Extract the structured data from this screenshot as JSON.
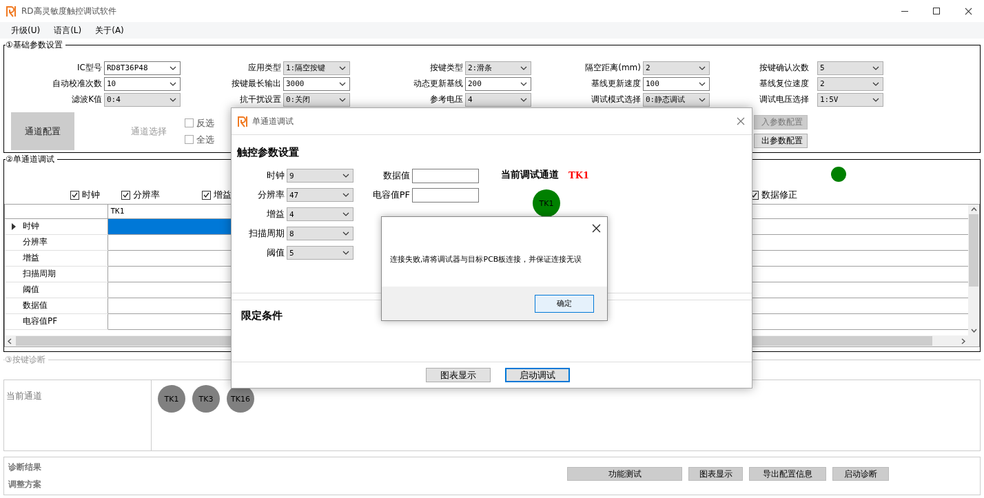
{
  "window": {
    "title": "RD高灵敏度触控调试软件"
  },
  "menu": [
    {
      "label": "升级(U)"
    },
    {
      "label": "语言(L)"
    },
    {
      "label": "关于(A)"
    }
  ],
  "basic": {
    "title": "①基础参数设置",
    "columns": [
      [
        {
          "label": "IC型号",
          "value": "RD8T36P48",
          "kind": "edit"
        },
        {
          "label": "自动校准次数",
          "value": "10",
          "kind": "edit"
        },
        {
          "label": "滤波K值",
          "value": "0:4",
          "kind": "list"
        }
      ],
      [
        {
          "label": "应用类型",
          "value": "1:隔空按键",
          "kind": "list"
        },
        {
          "label": "按键最长输出",
          "value": "3000",
          "kind": "edit"
        },
        {
          "label": "抗干扰设置",
          "value": "0:关闭",
          "kind": "list"
        }
      ],
      [
        {
          "label": "按键类型",
          "value": "2:滑条",
          "kind": "list"
        },
        {
          "label": "动态更新基线",
          "value": "200",
          "kind": "edit"
        },
        {
          "label": "参考电压",
          "value": "4",
          "kind": "list"
        }
      ],
      [
        {
          "label": "隔空距离(mm)",
          "value": "2",
          "kind": "list"
        },
        {
          "label": "基线更新速度",
          "value": "100",
          "kind": "edit"
        },
        {
          "label": "调试模式选择",
          "value": "0:静态调试",
          "kind": "list"
        }
      ],
      [
        {
          "label": "按键确认次数",
          "value": "5",
          "kind": "list"
        },
        {
          "label": "基线复位速度",
          "value": "2",
          "kind": "list"
        },
        {
          "label": "调试电压选择",
          "value": "1:5V",
          "kind": "list"
        }
      ]
    ],
    "channel_config_button": "通道配置",
    "channel_select_label": "通道选择",
    "select_options": [
      {
        "label": "反选",
        "checked": false
      },
      {
        "label": "全选",
        "checked": false
      }
    ],
    "side_buttons": [
      {
        "label": "入参数配置",
        "disabled": true
      },
      {
        "label": "出参数配置",
        "disabled": false
      }
    ]
  },
  "single": {
    "title": "②单通道调试",
    "checks_left": [
      {
        "label": "时钟",
        "checked": true
      },
      {
        "label": "分辨率",
        "checked": true
      },
      {
        "label": "增益",
        "checked": true
      }
    ],
    "checks_right": [
      {
        "label": "数据修正",
        "checked": true
      }
    ],
    "table": {
      "columns": [
        "TK1"
      ],
      "rows": [
        {
          "label": "时钟",
          "selected": true
        },
        {
          "label": "分辨率",
          "selected": false
        },
        {
          "label": "增益",
          "selected": false
        },
        {
          "label": "扫描周期",
          "selected": false
        },
        {
          "label": "阈值",
          "selected": false
        },
        {
          "label": "数据值",
          "selected": false
        },
        {
          "label": "电容值PF",
          "selected": false
        }
      ]
    }
  },
  "diagnosis": {
    "title": "③按键诊断",
    "current_label": "当前通道",
    "channels": [
      "TK1",
      "TK3",
      "TK16"
    ],
    "result_label": "诊断结果",
    "plan_label": "调整方案",
    "buttons": [
      "功能测试",
      "图表显示",
      "导出配置信息",
      "启动诊断"
    ]
  },
  "dialog": {
    "title": "单通道调试",
    "section": "触控参数设置",
    "params": [
      {
        "label": "时钟",
        "value": "9"
      },
      {
        "label": "分辨率",
        "value": "47"
      },
      {
        "label": "增益",
        "value": "4"
      },
      {
        "label": "扫描周期",
        "value": "8"
      },
      {
        "label": "阈值",
        "value": "5"
      }
    ],
    "fields": [
      {
        "label": "数据值"
      },
      {
        "label": "电容值PF"
      }
    ],
    "current_channel_label": "当前调试通道",
    "current_channel": "TK1",
    "channel_button": "TK1",
    "limits_title": "限定条件",
    "buttons": [
      {
        "label": "图表显示",
        "default": false
      },
      {
        "label": "启动调试",
        "default": true
      }
    ]
  },
  "message": {
    "text": "连接失败,请将调试器与目标PCB板连接，并保证连接无误",
    "ok": "确定"
  }
}
